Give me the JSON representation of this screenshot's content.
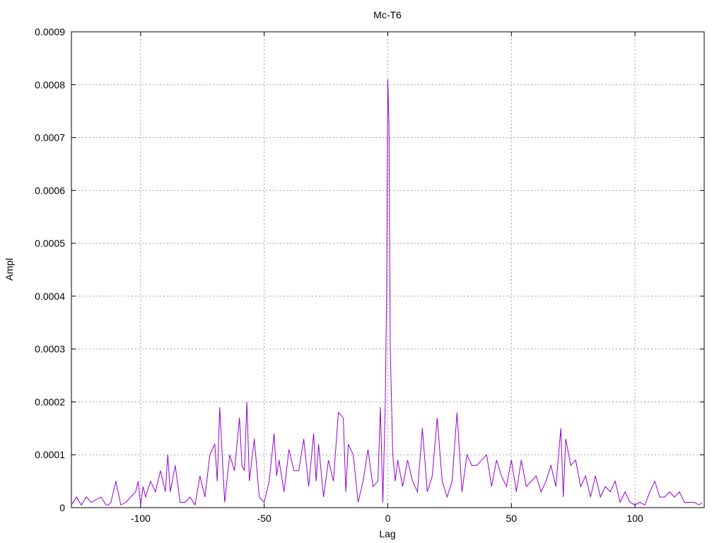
{
  "chart_data": {
    "type": "line",
    "title": "Mc-T6",
    "xlabel": "Lag",
    "ylabel": "Ampl",
    "xlim": [
      -128,
      128
    ],
    "ylim": [
      0,
      0.0009
    ],
    "xticks": [
      -100,
      -50,
      0,
      50,
      100
    ],
    "xtick_labels": [
      "-100",
      "-50",
      "0",
      "50",
      "100"
    ],
    "yticks": [
      0,
      0.0001,
      0.0002,
      0.0003,
      0.0004,
      0.0005,
      0.0006,
      0.0007,
      0.0008,
      0.0009
    ],
    "ytick_labels": [
      "0",
      "0.0001",
      "0.0002",
      "0.0003",
      "0.0004",
      "0.0005",
      "0.0006",
      "0.0007",
      "0.0008",
      "0.0009"
    ],
    "grid": true,
    "line_color": "#9400d3",
    "series": [
      {
        "x": [
          -128,
          -126,
          -124,
          -122,
          -120,
          -118,
          -116,
          -114,
          -113,
          -112,
          -110,
          -108,
          -106,
          -104,
          -102,
          -101,
          -100,
          -99,
          -98,
          -96,
          -94,
          -92,
          -90,
          -89,
          -88,
          -86,
          -84,
          -82,
          -80,
          -78,
          -76,
          -74,
          -72,
          -70,
          -69,
          -68,
          -66,
          -64,
          -62,
          -60,
          -59,
          -58,
          -57,
          -56,
          -54,
          -52,
          -50,
          -48,
          -46,
          -45,
          -44,
          -42,
          -40,
          -38,
          -36,
          -34,
          -32,
          -30,
          -29,
          -28,
          -26,
          -24,
          -22,
          -20,
          -18,
          -17,
          -16,
          -14,
          -12,
          -10,
          -8,
          -6,
          -4,
          -3,
          -2,
          -1,
          -0.5,
          0,
          0.5,
          1,
          2,
          3,
          4,
          6,
          8,
          10,
          12,
          14,
          16,
          18,
          20,
          22,
          24,
          26,
          28,
          30,
          32,
          34,
          36,
          38,
          40,
          42,
          44,
          46,
          48,
          50,
          52,
          54,
          56,
          58,
          60,
          62,
          64,
          66,
          68,
          70,
          71,
          72,
          74,
          76,
          78,
          80,
          82,
          84,
          86,
          88,
          90,
          92,
          94,
          96,
          98,
          100,
          102,
          104,
          106,
          108,
          110,
          112,
          114,
          116,
          118,
          120,
          122,
          124,
          126,
          127
        ],
        "y": [
          5e-06,
          2e-05,
          5e-06,
          2e-05,
          1e-05,
          1.5e-05,
          2e-05,
          5e-06,
          5e-06,
          1e-05,
          5e-05,
          5e-06,
          1e-05,
          2e-05,
          3e-05,
          5e-05,
          5e-06,
          4e-05,
          2e-05,
          5e-05,
          3e-05,
          7e-05,
          3e-05,
          0.0001,
          3e-05,
          8e-05,
          1e-05,
          1e-05,
          2e-05,
          5e-06,
          6e-05,
          2e-05,
          0.0001,
          0.00012,
          5e-05,
          0.00019,
          1e-05,
          0.0001,
          7e-05,
          0.00017,
          8e-05,
          7e-05,
          0.0002,
          5e-05,
          0.00013,
          2e-05,
          1e-05,
          5e-05,
          0.00014,
          6e-05,
          9e-05,
          3e-05,
          0.00011,
          7e-05,
          7e-05,
          0.00013,
          4e-05,
          0.00014,
          5e-05,
          0.00012,
          2e-05,
          9e-05,
          5e-05,
          0.00018,
          0.00017,
          3e-05,
          0.00012,
          0.0001,
          1e-05,
          5e-05,
          0.00011,
          4e-05,
          5e-05,
          0.00019,
          1e-05,
          0.0002,
          0.0004,
          0.00081,
          0.00072,
          0.0003,
          0.0001,
          5e-05,
          9e-05,
          4e-05,
          9e-05,
          5e-05,
          3e-05,
          0.00015,
          3e-05,
          6e-05,
          0.00017,
          5e-05,
          2e-05,
          5e-05,
          0.00018,
          3e-05,
          0.0001,
          8e-05,
          8e-05,
          9e-05,
          0.0001,
          4e-05,
          9e-05,
          6e-05,
          4e-05,
          9e-05,
          3e-05,
          9e-05,
          4e-05,
          5e-05,
          6e-05,
          3e-05,
          5e-05,
          8e-05,
          4e-05,
          0.00015,
          2e-05,
          0.00013,
          8e-05,
          9e-05,
          4e-05,
          6e-05,
          2e-05,
          6e-05,
          2e-05,
          4e-05,
          3e-05,
          5e-05,
          1e-05,
          3e-05,
          1e-05,
          5e-06,
          1e-05,
          5e-06,
          3e-05,
          5e-05,
          2e-05,
          2e-05,
          3e-05,
          2e-05,
          3e-05,
          1e-05,
          1e-05,
          1e-05,
          5e-06,
          1e-05
        ]
      }
    ]
  }
}
